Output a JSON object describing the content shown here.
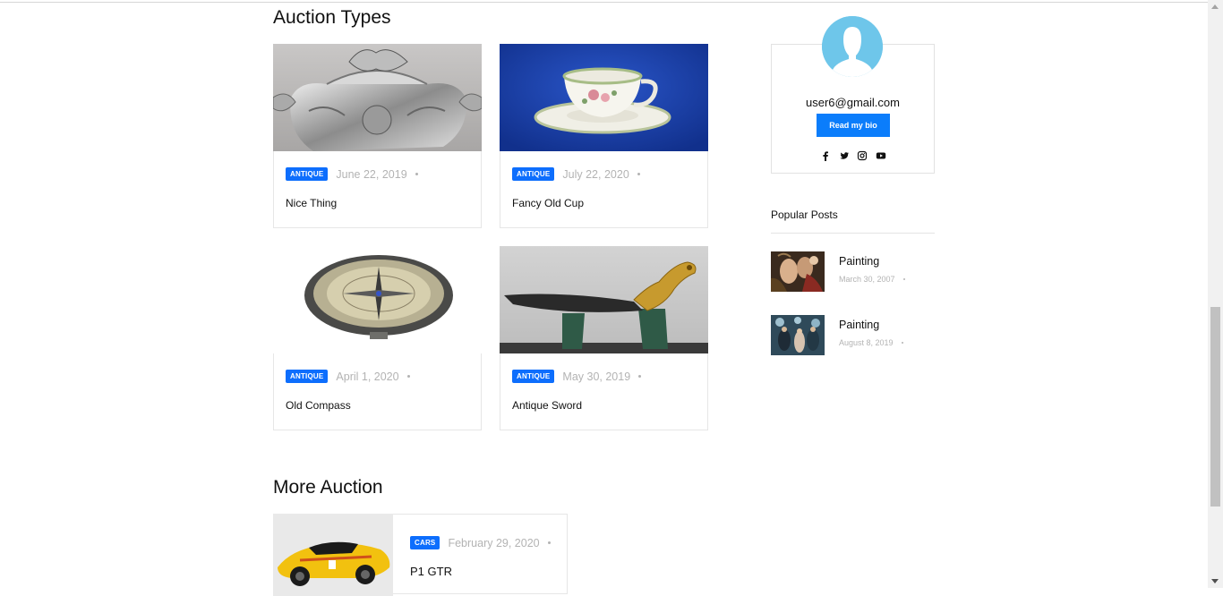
{
  "sections": {
    "auction_types_title": "Auction Types",
    "more_auction_title": "More Auction"
  },
  "cards": [
    {
      "badge": "ANTIQUE",
      "date": "June 22, 2019",
      "title": "Nice Thing"
    },
    {
      "badge": "ANTIQUE",
      "date": "July 22, 2020",
      "title": "Fancy Old Cup"
    },
    {
      "badge": "ANTIQUE",
      "date": "April 1, 2020",
      "title": "Old Compass"
    },
    {
      "badge": "ANTIQUE",
      "date": "May 30, 2019",
      "title": "Antique Sword"
    }
  ],
  "more_auction": [
    {
      "badge": "CARS",
      "date": "February 29, 2020",
      "title": "P1 GTR"
    }
  ],
  "profile": {
    "email": "user6@gmail.com",
    "bio_button": "Read my bio",
    "socials": [
      "facebook-icon",
      "twitter-icon",
      "instagram-icon",
      "youtube-icon"
    ]
  },
  "popular": {
    "title": "Popular Posts",
    "items": [
      {
        "title": "Painting",
        "date": "March 30, 2007"
      },
      {
        "title": "Painting",
        "date": "August 8, 2019"
      }
    ]
  },
  "colors": {
    "accent": "#0d6efd",
    "avatar": "#6ec6ea",
    "muted": "#b3b3b3"
  }
}
